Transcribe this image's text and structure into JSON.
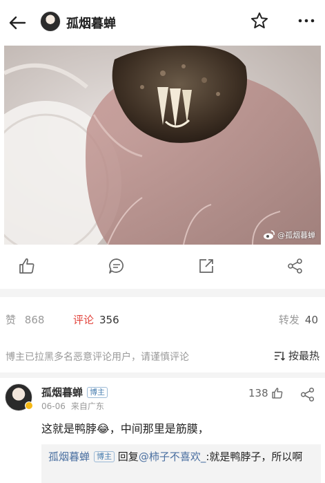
{
  "header": {
    "title": "孤烟暮蝉"
  },
  "photo": {
    "watermark": "@孤烟暮蝉"
  },
  "stats": {
    "like_label": "赞",
    "like_count": "868",
    "comment_label": "评论",
    "comment_count": "356",
    "repost_label": "转发",
    "repost_count": "40"
  },
  "notice": {
    "text": "博主已拉黑多名恶意评论用户，请谨慎评论",
    "sort_label": "按最热"
  },
  "comment": {
    "author": "孤烟暮蝉",
    "badge": "博主",
    "date": "06-06",
    "location": "来自广东",
    "likes": "138",
    "text": "这就是鸭脖😂，中间那里是筋膜，",
    "reply": {
      "author": "孤烟暮蝉",
      "badge": "博主",
      "prefix": "回复",
      "mention": "@柿子不喜欢_",
      "text": ":就是鸭脖子，所以啊"
    }
  },
  "colors": {
    "accent_red": "#e2443c",
    "link_blue": "#4a6fa0",
    "muted_gray": "#999999"
  },
  "icons": [
    "back-arrow-icon",
    "star-icon",
    "more-icon",
    "like-icon",
    "comment-icon",
    "repost-icon",
    "share-icon",
    "sort-icon",
    "weibo-logo-icon"
  ]
}
